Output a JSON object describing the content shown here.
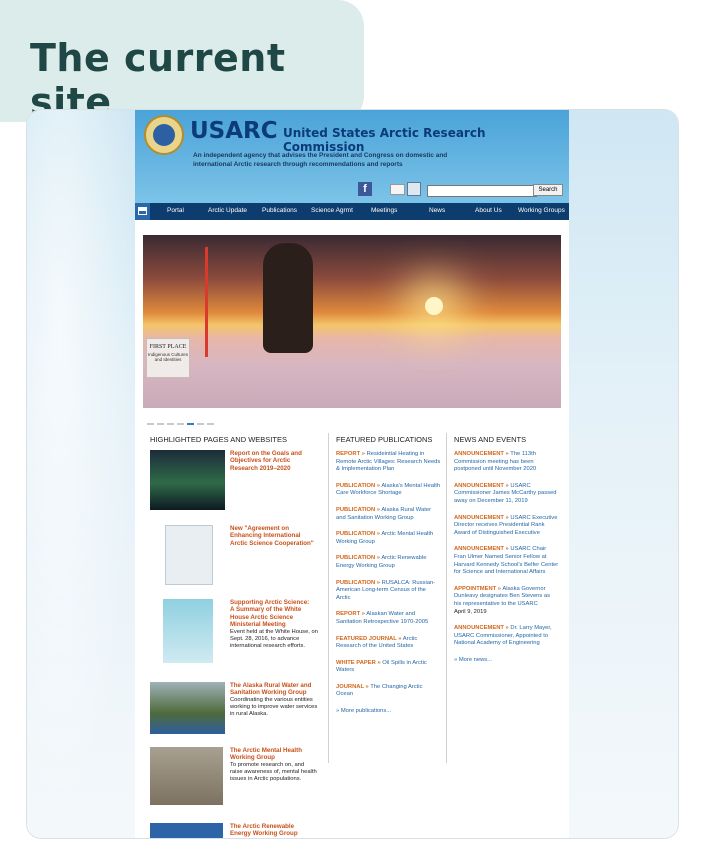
{
  "slide_heading": "The current site",
  "site": {
    "abbr": "USARC",
    "name": "United States Arctic Research Commission",
    "description": "An independent agency that advises the President and Congress on domestic and international Arctic research through recommendations and reports",
    "search": {
      "placeholder": "",
      "button": "Search"
    },
    "facebook_glyph": "f",
    "nav": [
      "Portal",
      "Arctic Update",
      "Publications",
      "Science Agrmt",
      "Meetings",
      "News",
      "About Us",
      "Working Groups"
    ],
    "hero": {
      "caption_title": "FIRST PLACE",
      "caption_sub": "Indigenous Cultures and Identities",
      "slide_count": 7,
      "active_slide": 5
    },
    "highlighted": {
      "heading": "HIGHLIGHTED PAGES AND WEBSITES",
      "items": [
        {
          "title": "Report on the Goals and Objectives for Arctic Research 2019–2020",
          "desc": ""
        },
        {
          "title": "New \"Agreement on Enhancing International Arctic Science Cooperation\"",
          "desc": ""
        },
        {
          "title": "Supporting Arctic Science: A Summary of the White House Arctic Science Ministerial Meeting",
          "desc": "Event held at the White House, on Sept. 28, 2016, to advance international research efforts."
        },
        {
          "title": "The Alaska Rural Water and Sanitation Working Group",
          "desc": "Coordinating the various entities working to improve water services in rural Alaska."
        },
        {
          "title": "The Arctic Mental Health Working Group",
          "desc": "To promote research on, and raise awareness of, mental health issues in Arctic populations."
        },
        {
          "title": "The Arctic Renewable Energy Working Group",
          "desc": ""
        }
      ]
    },
    "publications": {
      "heading": "FEATURED PUBLICATIONS",
      "items": [
        {
          "tag": "REPORT »",
          "text": "Resideintial Heating in Remote Arctic Villages: Research Needs & Implementation Plan"
        },
        {
          "tag": "PUBLICATION »",
          "text": "Alaska's Mental Health Care Workforce Shortage"
        },
        {
          "tag": "PUBLICATION »",
          "text": "Alaska Rural Water and Sanitation Working Group"
        },
        {
          "tag": "PUBLICATION »",
          "text": "Arctic Mental Health Working Group"
        },
        {
          "tag": "PUBLICATION »",
          "text": "Arctic Renewable Energy Working Group"
        },
        {
          "tag": "PUBLICATION »",
          "text": "RUSALCA: Russian-American Long-term Census of the Arctic"
        },
        {
          "tag": "REPORT »",
          "text": "Alaskan Water and Sanitation Retrospective 1970-2005"
        },
        {
          "tag": "FEATURED JOURNAL »",
          "text": "Arctic Research of the United States"
        },
        {
          "tag": "WHITE PAPER »",
          "text": "Oil Spills in Arctic Waters"
        },
        {
          "tag": "JOURNAL »",
          "text": "The Changing Arctic Ocean"
        }
      ],
      "more": "» More publications..."
    },
    "news": {
      "heading": "NEWS AND EVENTS",
      "items": [
        {
          "tag": "ANNOUNCEMENT »",
          "text": "The 113th Commission meeting has been postponed until November 2020",
          "date": ""
        },
        {
          "tag": "ANNOUNCEMENT »",
          "text": "USARC Commissioner James McCarthy passed away on December 11, 2019",
          "date": ""
        },
        {
          "tag": "ANNOUNCEMENT »",
          "text": "USARC Executive Director receives Presidential Rank Award of Distinguished Executive",
          "date": ""
        },
        {
          "tag": "ANNOUNCEMENT »",
          "text": "USARC Chair Fran Ulmer Named Senior Fellow at Harvard Kennedy School's Belfer Center for Science and International Affairs",
          "date": ""
        },
        {
          "tag": "APPOINTMENT »",
          "text": "Alaska Governor Dunleavy designates Ben Stevens as his representative to the USARC",
          "date": "April 9, 2019"
        },
        {
          "tag": "ANNOUNCEMENT »",
          "text": "Dr. Larry Mayer, USARC Commissioner, Appointed to National Academy of Engineering",
          "date": ""
        }
      ],
      "more": "» More news..."
    }
  }
}
